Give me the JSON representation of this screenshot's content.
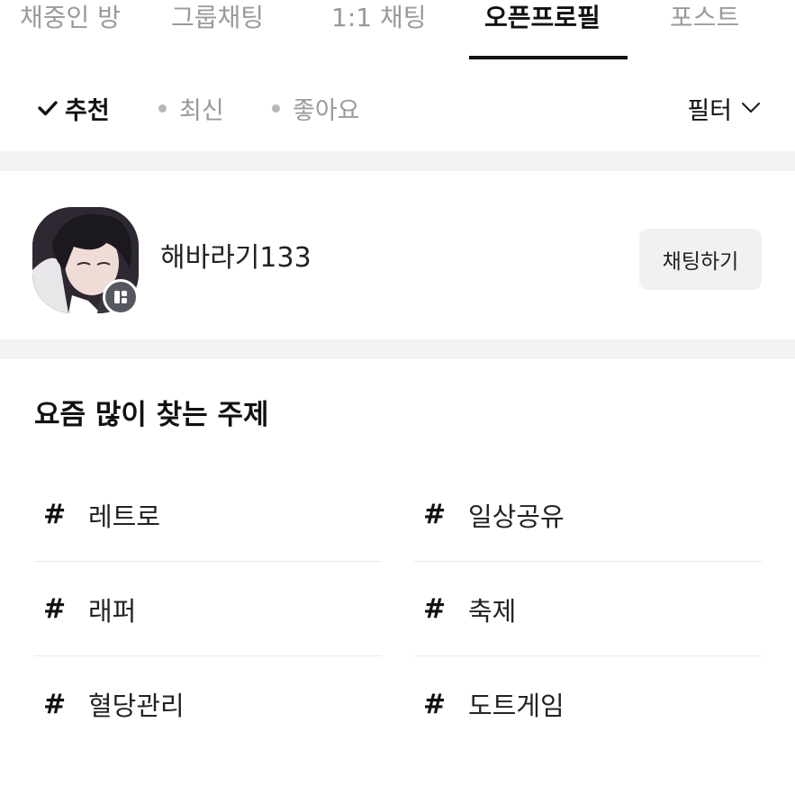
{
  "tabs": [
    {
      "label": "채중인 방"
    },
    {
      "label": "그룹채팅"
    },
    {
      "label": "1:1 채팅"
    },
    {
      "label": "오픈프로필",
      "active": true
    },
    {
      "label": "포스트"
    }
  ],
  "sort": {
    "options": [
      {
        "label": "추천",
        "active": true
      },
      {
        "label": "최신"
      },
      {
        "label": "좋아요"
      }
    ],
    "filter_label": "필터"
  },
  "profile": {
    "name": "해바라기133",
    "chat_button_label": "채팅하기"
  },
  "topics_section": {
    "title": "요즘 많이 찾는 주제",
    "hash_symbol": "#",
    "topics": [
      "레트로",
      "일상공유",
      "래퍼",
      "축제",
      "혈당관리",
      "도트게임"
    ]
  }
}
